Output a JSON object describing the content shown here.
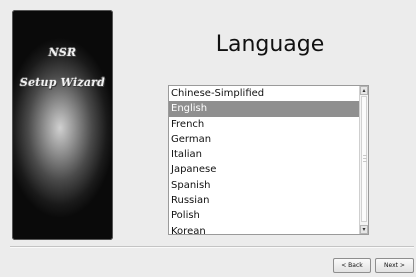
{
  "side_panel": {
    "line1": "NSR",
    "line2": "Setup Wizard"
  },
  "page_title": "Language",
  "language_list": {
    "items": [
      "Chinese-Simplified",
      "English",
      "French",
      "German",
      "Italian",
      "Japanese",
      "Spanish",
      "Russian",
      "Polish",
      "Korean"
    ],
    "selected": "English"
  },
  "buttons": {
    "back_label": "< Back",
    "next_label": "Next >"
  },
  "colors": {
    "selection": "#8f8f8f",
    "background": "#ececec"
  }
}
